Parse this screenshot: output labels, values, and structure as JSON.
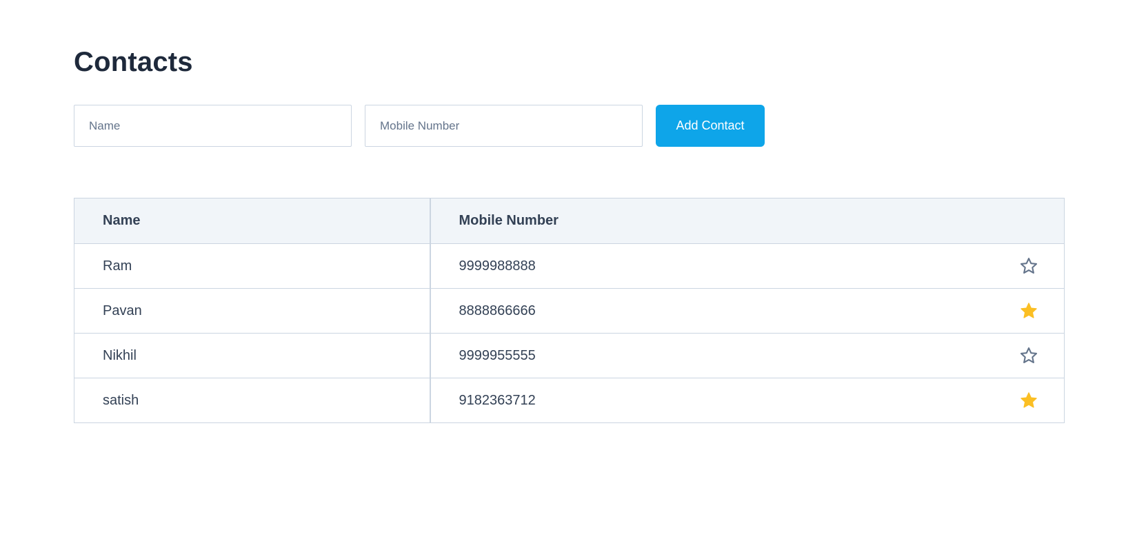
{
  "page": {
    "title": "Contacts"
  },
  "form": {
    "name_placeholder": "Name",
    "name_value": "",
    "mobile_placeholder": "Mobile Number",
    "mobile_value": "",
    "add_button_label": "Add Contact"
  },
  "table": {
    "headers": {
      "name": "Name",
      "mobile": "Mobile Number"
    },
    "rows": [
      {
        "name": "Ram",
        "mobile": "9999988888",
        "favorite": false
      },
      {
        "name": "Pavan",
        "mobile": "8888866666",
        "favorite": true
      },
      {
        "name": "Nikhil",
        "mobile": "9999955555",
        "favorite": false
      },
      {
        "name": "satish",
        "mobile": "9182363712",
        "favorite": true
      }
    ]
  },
  "colors": {
    "accent": "#0ea5e9",
    "star_active": "#fbbf24",
    "star_inactive": "#64748b",
    "header_bg": "#f1f5f9",
    "border": "#cbd5e1"
  },
  "icons": {
    "favorite_active": "star-filled-icon",
    "favorite_inactive": "star-outline-icon"
  }
}
